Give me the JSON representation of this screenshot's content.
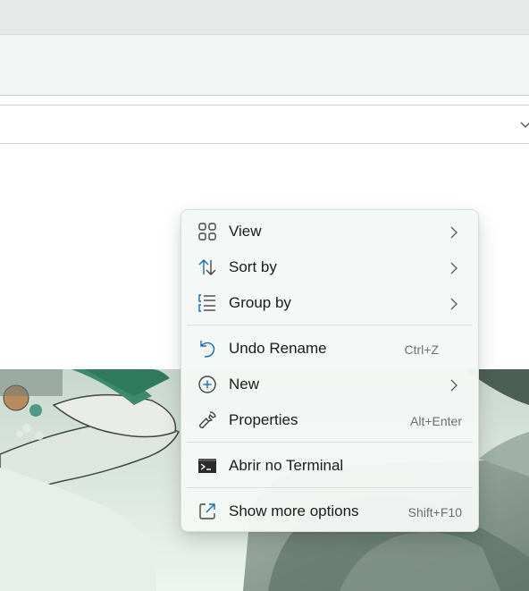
{
  "context_menu": {
    "items": [
      {
        "label": "View",
        "icon": "grid-view-icon",
        "submenu": true
      },
      {
        "label": "Sort by",
        "icon": "sort-arrows-icon",
        "submenu": true
      },
      {
        "label": "Group by",
        "icon": "group-list-icon",
        "submenu": true
      },
      {
        "label": "Undo Rename",
        "icon": "undo-icon",
        "shortcut": "Ctrl+Z"
      },
      {
        "label": "New",
        "icon": "plus-circle-icon",
        "submenu": true
      },
      {
        "label": "Properties",
        "icon": "wrench-icon",
        "shortcut": "Alt+Enter"
      },
      {
        "label": "Abrir no Terminal",
        "icon": "terminal-icon"
      },
      {
        "label": "Show more options",
        "icon": "external-open-icon",
        "shortcut": "Shift+F10"
      }
    ]
  },
  "colors": {
    "accent": "#0f6cbd",
    "menu_background": "#f4f8f6",
    "wallpaper_tone": "#8fa39a"
  }
}
